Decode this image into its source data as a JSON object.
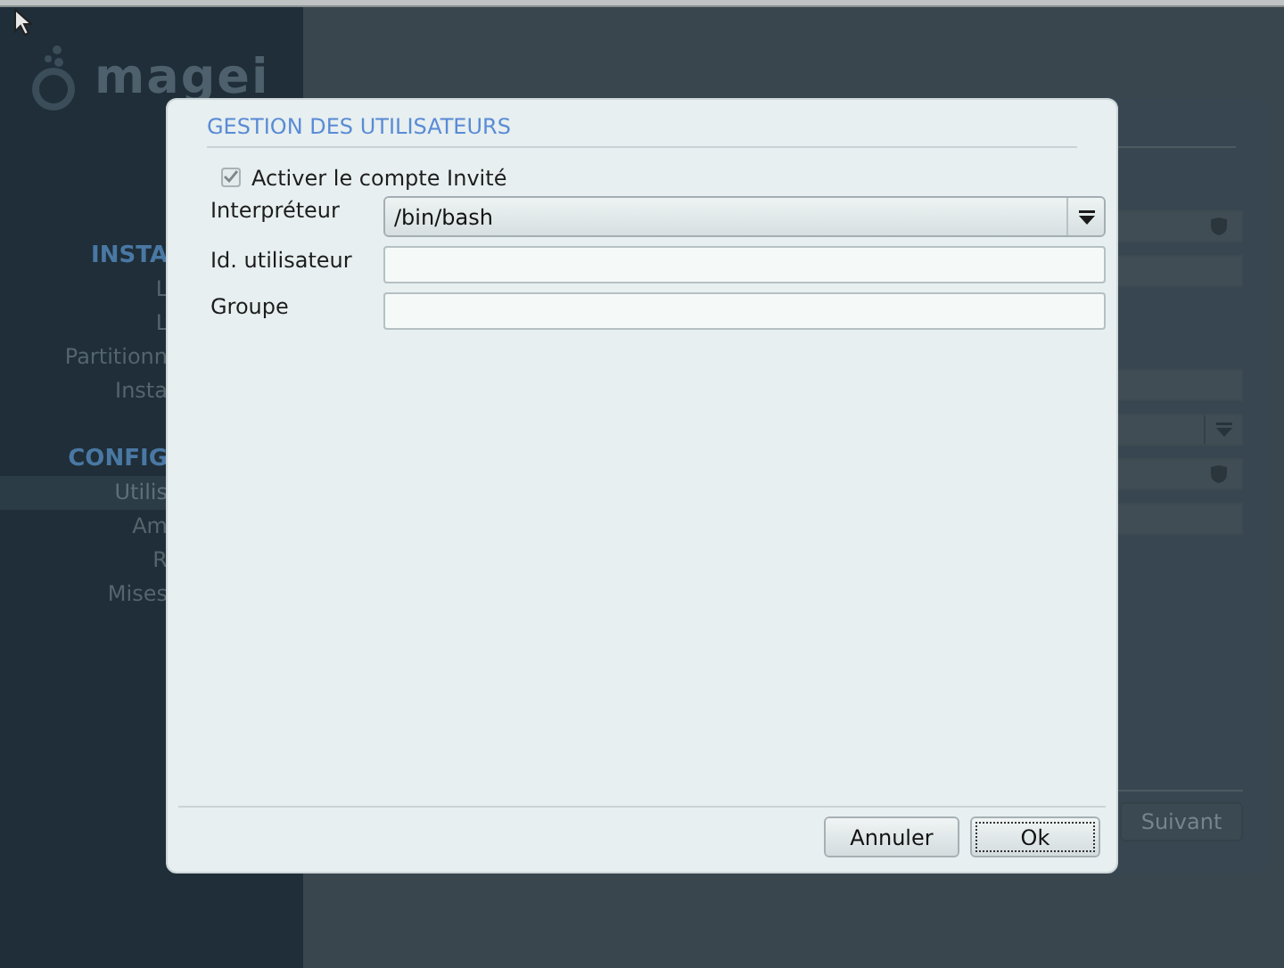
{
  "sidebar": {
    "logo": "magei",
    "sections": [
      {
        "title": "INSTA",
        "items": [
          {
            "label": "L",
            "selected": false
          },
          {
            "label": "L",
            "selected": false
          },
          {
            "label": "Partitionn",
            "selected": false
          },
          {
            "label": "Insta",
            "selected": false
          }
        ]
      },
      {
        "title": "CONFIG",
        "items": [
          {
            "label": "Utilis",
            "selected": true
          },
          {
            "label": "Am",
            "selected": false
          },
          {
            "label": "R",
            "selected": false
          },
          {
            "label": "Mises",
            "selected": false
          }
        ]
      }
    ]
  },
  "background_form": {
    "field_groups": [
      [
        {
          "kind": "secret"
        },
        {
          "kind": "text"
        }
      ],
      [
        {
          "kind": "text"
        },
        {
          "kind": "combo"
        },
        {
          "kind": "secret"
        },
        {
          "kind": "text"
        }
      ]
    ],
    "next_button": "Suivant"
  },
  "dialog": {
    "title": "GESTION DES UTILISATEURS",
    "guest_account": {
      "label": "Activer le compte Invité",
      "checked": true
    },
    "fields": [
      {
        "kind": "combo",
        "label": "Interpréteur",
        "value": "/bin/bash"
      },
      {
        "kind": "text",
        "label": "Id. utilisateur"
      },
      {
        "kind": "text",
        "label": "Groupe"
      }
    ],
    "buttons": [
      {
        "label": "Annuler",
        "focused": false
      },
      {
        "label": "Ok",
        "focused": true
      }
    ]
  }
}
